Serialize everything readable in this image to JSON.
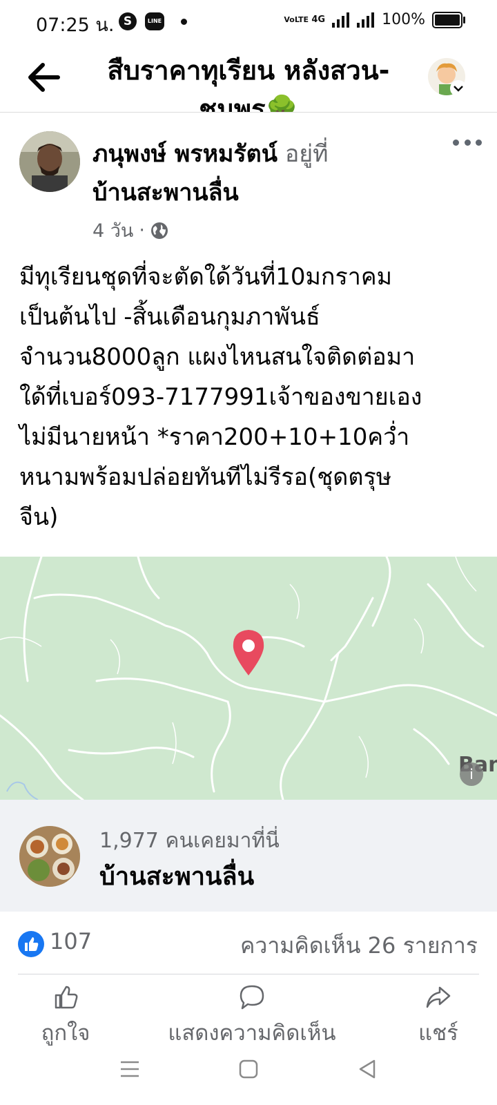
{
  "status_bar": {
    "time": "07:25 น.",
    "network": "4G",
    "battery": "100%"
  },
  "header": {
    "title": "สืบราคาทุเรียน หลังสวน-ชุมพร🌳"
  },
  "post": {
    "author": "ภนุพงษ์ พรหมรัตน์",
    "at_text": "อยู่ที่",
    "place": "บ้านสะพานลื่น",
    "time": "4 วัน",
    "body": "มีทุเรียนชุดที่จะตัดใด้วันที่10มกราคม\nเป็นต้นไป -สิ้นเดือนกุมภาพันธ์\nจำนวน8000ลูก แผงไหนสนใจติดต่อมา\nใด้ที่เบอร์093-7177991เจ้าของขายเอง\nไม่มีนายหน้า *ราคา200+10+10คว่ำ\nหนามพร้อมปล่อยทันทีไม่รีรอ(ชุดตรุษ\nจีน)"
  },
  "map": {
    "label": "Ban"
  },
  "place_card": {
    "visits": "1,977 คนเคยมาที่นี่",
    "name": "บ้านสะพานลื่น"
  },
  "reactions": {
    "likes": "107",
    "comments": "ความคิดเห็น 26 รายการ"
  },
  "actions": {
    "like": "ถูกใจ",
    "comment": "แสดงความคิดเห็น",
    "share": "แชร์"
  },
  "icons": {
    "back": "arrow-left-icon",
    "more": "more-dots-icon",
    "globe": "globe-icon",
    "pin": "map-pin-icon"
  },
  "colors": {
    "brand_blue": "#1877f2",
    "pin_red": "#e84a5f",
    "map_green": "#cfe8cf"
  }
}
